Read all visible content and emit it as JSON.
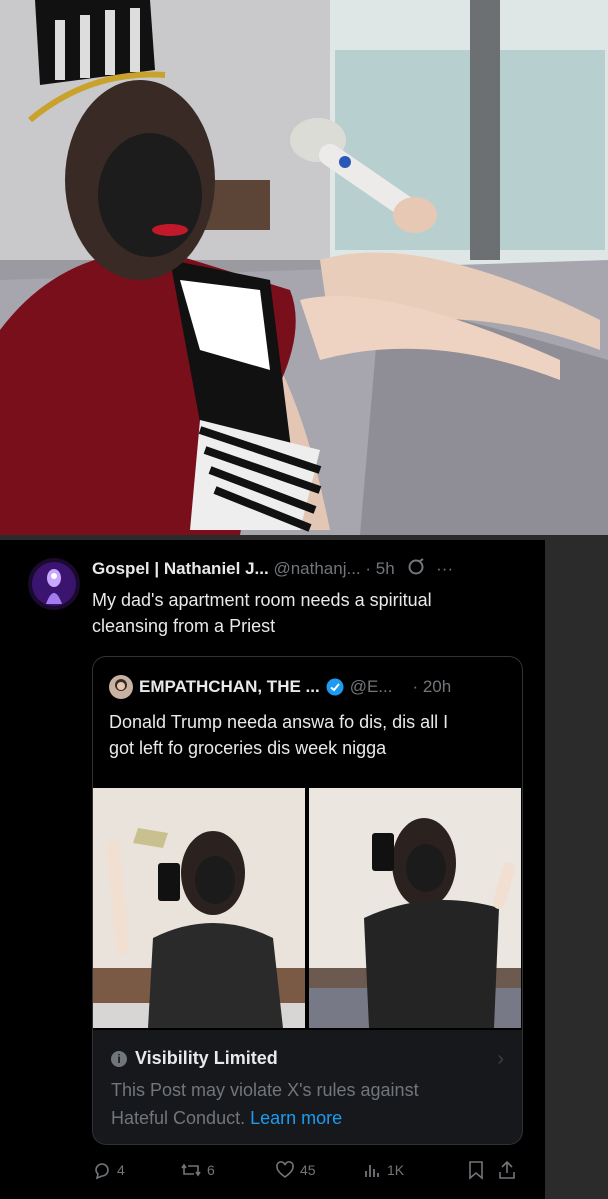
{
  "tweet": {
    "author_name": "Gospel | Nathaniel J...",
    "author_handle": "@nathanj...",
    "time": "· 5h",
    "text_line1": "My dad's apartment room needs a spiritual",
    "text_line2": "cleansing from a Priest",
    "quoted": {
      "author_name": "EMPATHCHAN, THE ...",
      "author_handle": "@E...",
      "time": "· 20h",
      "text_line1": "Donald Trump needa answa fo dis, dis all I",
      "text_line2": "got left fo groceries dis week nigga"
    },
    "visibility": {
      "title": "Visibility Limited",
      "text_line1": "This Post may violate X's rules against",
      "text_line2_prefix": "Hateful Conduct.",
      "link": "Learn more"
    },
    "actions": {
      "replies": "4",
      "reposts": "6",
      "likes": "45",
      "views": "1K"
    }
  },
  "colors": {
    "background": "#000000",
    "text": "#e7e9ea",
    "muted": "#71767b",
    "link": "#1d9bf0",
    "verified": "#1d9bf0"
  }
}
